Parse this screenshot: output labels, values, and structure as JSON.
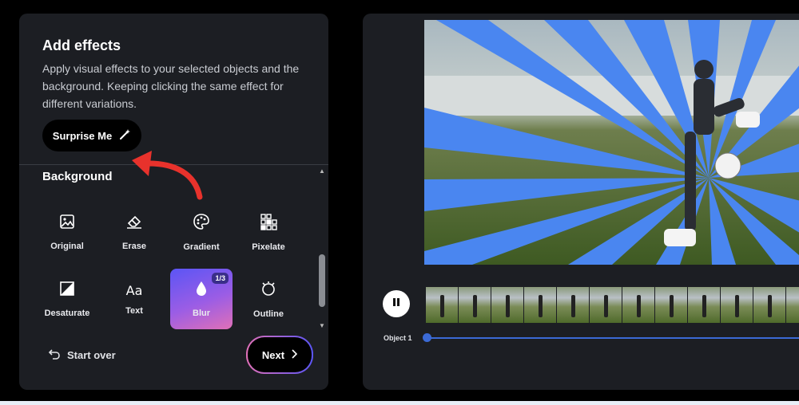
{
  "panel": {
    "title": "Add effects",
    "description": "Apply visual effects to your selected objects and the background. Keeping clicking the same effect for different variations.",
    "surprise_label": "Surprise Me",
    "section_label": "Background",
    "effects": [
      {
        "label": "Original",
        "icon": "image-icon"
      },
      {
        "label": "Erase",
        "icon": "eraser-icon"
      },
      {
        "label": "Gradient",
        "icon": "palette-icon"
      },
      {
        "label": "Pixelate",
        "icon": "pixelate-icon"
      },
      {
        "label": "Desaturate",
        "icon": "desaturate-icon"
      },
      {
        "label": "Text",
        "icon": "text-icon",
        "glyph": "Aa"
      },
      {
        "label": "Blur",
        "icon": "drop-icon",
        "badge": "1/3",
        "selected": true
      },
      {
        "label": "Outline",
        "icon": "outline-icon"
      }
    ],
    "start_over_label": "Start over",
    "next_label": "Next"
  },
  "timeline": {
    "object_label": "Object 1"
  },
  "colors": {
    "panel_bg": "#1c1e23",
    "accent_blue": "#3b6ad6",
    "ray_blue": "#4a86f0",
    "annotation_red": "#e8322c"
  }
}
